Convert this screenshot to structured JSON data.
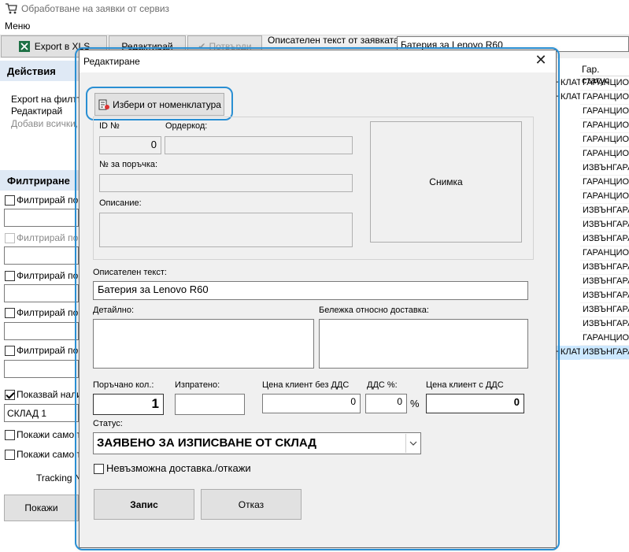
{
  "window": {
    "title": "Обработване на заявки от сервиз"
  },
  "menu": {
    "items": [
      "Меню"
    ]
  },
  "toolbar": {
    "export_label": "Export в XLS",
    "edit_label": "Редактирай",
    "confirm_label": "Потвърди",
    "desc_label": "Описателен текст от заявката:",
    "desc_value": "Батерия за Lenovo R60"
  },
  "left": {
    "actions_title": "Действия",
    "actions": [
      "Export на филтъ",
      "Редактирай",
      "Добави всички, з"
    ],
    "filter_title": "Филтриране",
    "filters": [
      "Филтрирай по се",
      "Филтрирай по ф",
      "Филтрирай по с",
      "Филтрирай по т",
      "Филтрирай по к"
    ],
    "show_stock_label": "Показвай нали",
    "stock_value": "СКЛАД 1",
    "only1_label": "Покажи само те",
    "only2_label": "Покажи само те",
    "tracking_label": "Tracking Nu",
    "show_button": "Покажи"
  },
  "grid": {
    "header": "Гар. статус",
    "rows": [
      {
        "left": "НКЛАТУ",
        "status": "ГАРАНЦИОН"
      },
      {
        "left": "НКЛАТУ",
        "status": "ГАРАНЦИОН"
      },
      {
        "left": "",
        "status": "ГАРАНЦИОН"
      },
      {
        "left": "",
        "status": "ГАРАНЦИОН"
      },
      {
        "left": "",
        "status": "ГАРАНЦИОН"
      },
      {
        "left": "",
        "status": "ГАРАНЦИОН"
      },
      {
        "left": "",
        "status": "ИЗВЪНГАРА"
      },
      {
        "left": "",
        "status": "ГАРАНЦИОН"
      },
      {
        "left": "",
        "status": "ГАРАНЦИОН"
      },
      {
        "left": "",
        "status": "ИЗВЪНГАРА"
      },
      {
        "left": "",
        "status": "ИЗВЪНГАРА"
      },
      {
        "left": "",
        "status": "ИЗВЪНГАРА"
      },
      {
        "left": "",
        "status": "ГАРАНЦИОН"
      },
      {
        "left": "",
        "status": "ИЗВЪНГАРА"
      },
      {
        "left": "",
        "status": "ИЗВЪНГАРА"
      },
      {
        "left": "",
        "status": "ИЗВЪНГАРА"
      },
      {
        "left": "",
        "status": "ИЗВЪНГАРА"
      },
      {
        "left": "",
        "status": "ИЗВЪНГАРА"
      },
      {
        "left": "",
        "status": "ГАРАНЦИОН"
      },
      {
        "left": "НКЛАТУ",
        "status": "ИЗВЪНГАРА",
        "selected": true
      }
    ]
  },
  "dialog": {
    "title": "Редактиране",
    "close": "✕",
    "choose_button": "Избери от номенклатура",
    "id_label": "ID №",
    "id_value": "0",
    "ordercode_label": "Ордеркод:",
    "ordercode_value": "",
    "order_no_label": "№ за поръчка:",
    "order_no_value": "",
    "description_label": "Описание:",
    "description_value": "",
    "photo_label": "Снимка",
    "desc_text_label": "Описателен текст:",
    "desc_text_value": "Батерия за Lenovo R60",
    "detail_label": "Детайлно:",
    "detail_value": "",
    "delivery_note_label": "Бележка относно доставка:",
    "delivery_note_value": "",
    "ordered_label": "Поръчано кол.:",
    "ordered_value": "1",
    "sent_label": "Изпратено:",
    "sent_value": "",
    "price_novat_label": "Цена клиент без ДДС",
    "price_novat_value": "0",
    "vat_label": "ДДС %:",
    "vat_value": "0",
    "percent": "%",
    "price_vat_label": "Цена клиент с ДДС",
    "price_vat_value": "0",
    "status_label": "Статус:",
    "status_value": "ЗАЯВЕНО ЗА ИЗПИСВАНЕ ОТ СКЛАД",
    "impossible_label": "Невъзможна доставка./откажи",
    "save_button": "Запис",
    "cancel_button": "Отказ"
  }
}
